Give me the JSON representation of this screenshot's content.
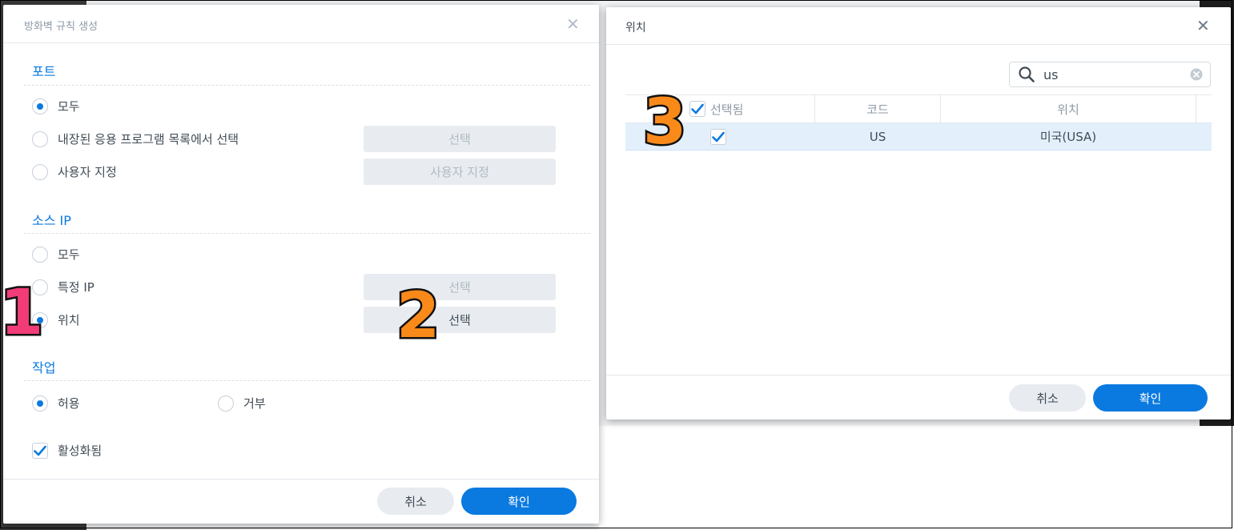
{
  "left_dialog": {
    "title": "방화벽 규칙 생성",
    "close_glyph": "✕",
    "ports": {
      "heading": "포트",
      "options": [
        {
          "label": "모두",
          "selected": true
        },
        {
          "label": "내장된 응용 프로그램 목록에서 선택",
          "selected": false
        },
        {
          "label": "사용자 지정",
          "selected": false
        }
      ],
      "select_button": "선택",
      "custom_button": "사용자 지정"
    },
    "source_ip": {
      "heading": "소스 IP",
      "options": [
        {
          "label": "모두",
          "selected": false
        },
        {
          "label": "특정 IP",
          "selected": false
        },
        {
          "label": "위치",
          "selected": true
        }
      ],
      "specific_select_button": "선택",
      "location_select_button": "선택"
    },
    "action": {
      "heading": "작업",
      "allow_label": "허용",
      "allow_selected": true,
      "deny_label": "거부",
      "deny_selected": false
    },
    "enabled_label": "활성화됨",
    "enabled_checked": true,
    "cancel_label": "취소",
    "ok_label": "확인"
  },
  "right_dialog": {
    "title": "위치",
    "close_glyph": "✕",
    "search": {
      "value": "us",
      "icon": "search-icon",
      "clear_icon": "clear-icon"
    },
    "columns": {
      "selected": "선택됨",
      "code": "코드",
      "location": "위치"
    },
    "rows": [
      {
        "checked": true,
        "code": "US",
        "location": "미국(USA)"
      }
    ],
    "cancel_label": "취소",
    "ok_label": "확인"
  },
  "annotations": [
    {
      "label": "1",
      "color": "#f23c78"
    },
    {
      "label": "2",
      "color": "#f98a1a"
    },
    {
      "label": "3",
      "color": "#f98a1a"
    }
  ],
  "colors": {
    "accent": "#0a7ae0",
    "button_gray": "#e8ecf1",
    "row_highlight": "#e3f0fc"
  }
}
